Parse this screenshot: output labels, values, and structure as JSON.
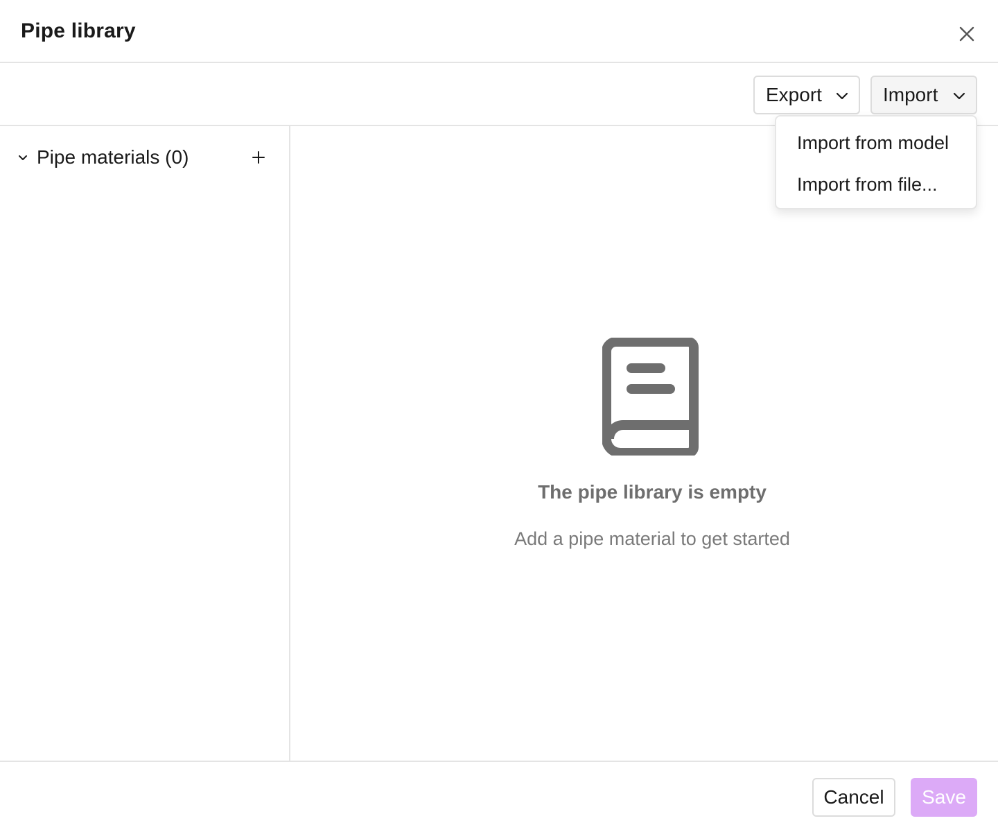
{
  "dialog": {
    "title": "Pipe library"
  },
  "toolbar": {
    "export_label": "Export",
    "import_label": "Import"
  },
  "import_menu": {
    "items": [
      {
        "label": "Import from model"
      },
      {
        "label": "Import from file..."
      }
    ]
  },
  "sidebar": {
    "group_label": "Pipe materials (0)",
    "expanded": true
  },
  "empty_state": {
    "icon": "book-icon",
    "title": "The pipe library is empty",
    "subtitle": "Add a pipe material to get started"
  },
  "footer": {
    "cancel_label": "Cancel",
    "save_label": "Save",
    "save_enabled": false
  },
  "colors": {
    "accent_disabled": "#dcaaf7",
    "border": "#e4e4e4",
    "icon_gray": "#6e6e6e"
  }
}
